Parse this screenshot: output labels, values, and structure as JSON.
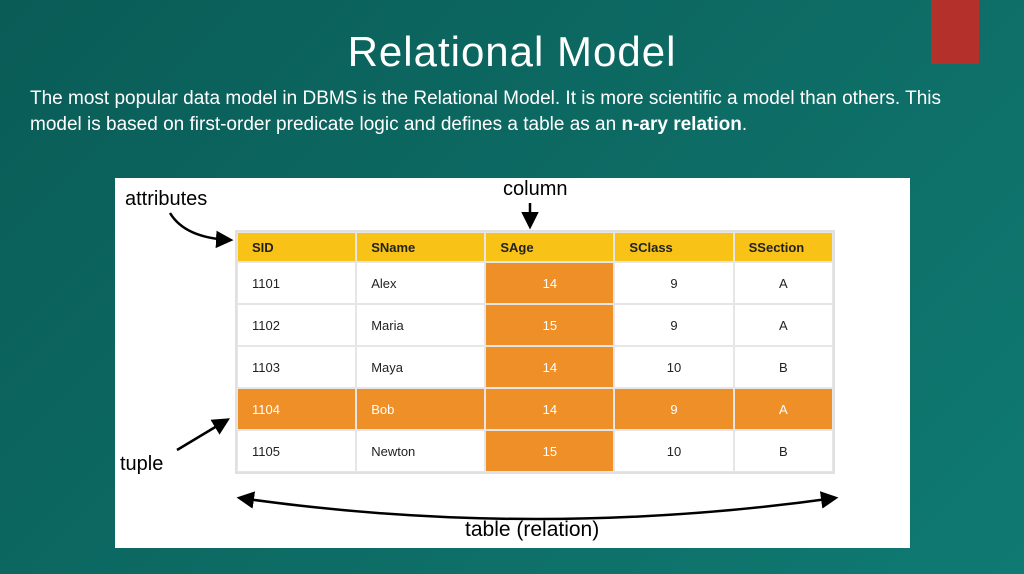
{
  "title": "Relational Model",
  "description_pre": "The most popular data model in DBMS is the Relational Model. It is more scientific a model than others. This model is based on first-order predicate logic and defines a table as an ",
  "description_bold": "n-ary relation",
  "description_post": ".",
  "labels": {
    "attributes": "attributes",
    "column": "column",
    "tuple": "tuple",
    "table": "table (relation)"
  },
  "chart_data": {
    "type": "table",
    "columns": [
      "SID",
      "SName",
      "SAge",
      "SClass",
      "SSection"
    ],
    "rows": [
      {
        "SID": "1101",
        "SName": "Alex",
        "SAge": "14",
        "SClass": "9",
        "SSection": "A",
        "highlight": false
      },
      {
        "SID": "1102",
        "SName": "Maria",
        "SAge": "15",
        "SClass": "9",
        "SSection": "A",
        "highlight": false
      },
      {
        "SID": "1103",
        "SName": "Maya",
        "SAge": "14",
        "SClass": "10",
        "SSection": "B",
        "highlight": false
      },
      {
        "SID": "1104",
        "SName": "Bob",
        "SAge": "14",
        "SClass": "9",
        "SSection": "A",
        "highlight": true
      },
      {
        "SID": "1105",
        "SName": "Newton",
        "SAge": "15",
        "SClass": "10",
        "SSection": "B",
        "highlight": false
      }
    ],
    "highlighted_column": "SAge",
    "highlighted_row_index": 3,
    "annotations": {
      "attributes_points_to": "header row",
      "column_points_to": "SAge column",
      "tuple_points_to": "row 1104",
      "table_label": "whole table"
    }
  },
  "colors": {
    "background_start": "#0a5c57",
    "background_end": "#0f7a72",
    "accent_red": "#b4302a",
    "header_yellow": "#f9c216",
    "highlight_orange": "#ee8f28"
  }
}
